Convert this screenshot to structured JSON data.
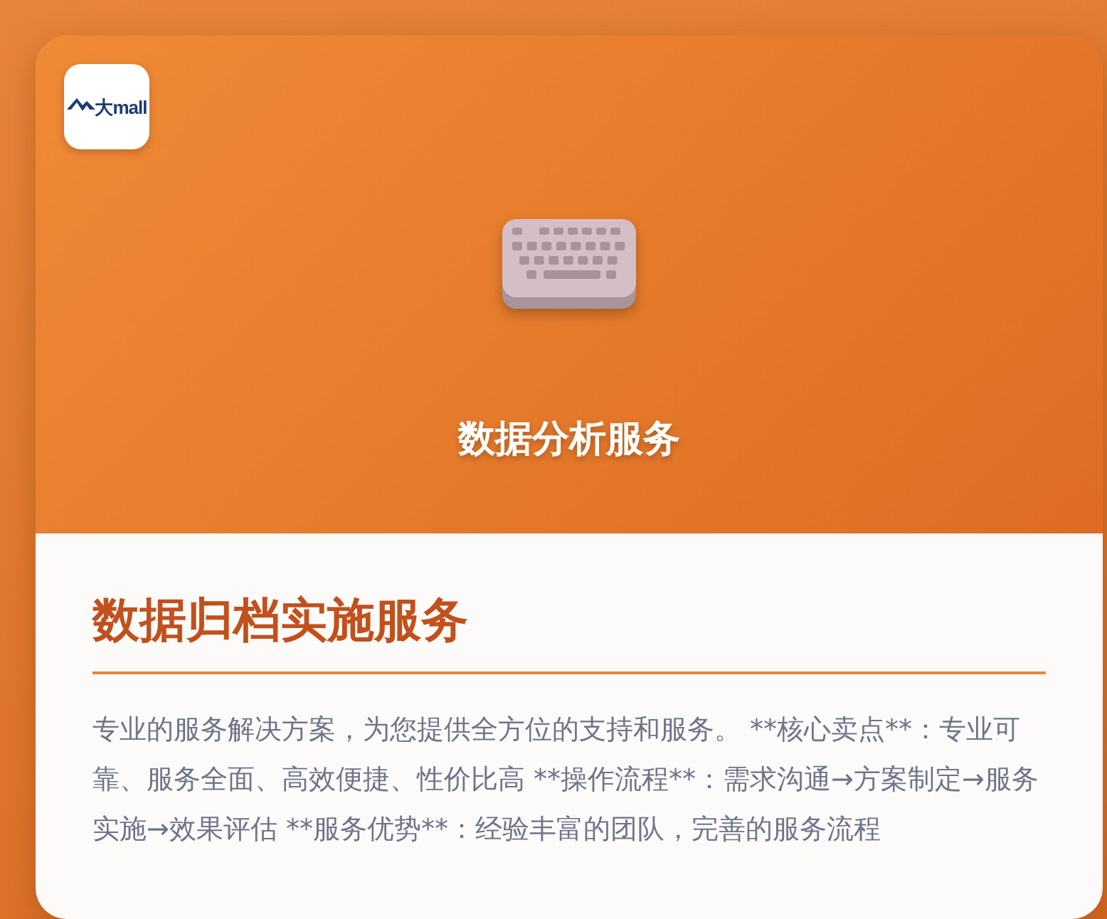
{
  "header": {
    "logo_text": "大mall",
    "title": "数据分析服务"
  },
  "content": {
    "heading": "数据归档实施服务",
    "description": "专业的服务解决方案，为您提供全方位的支持和服务。 **核心卖点**：专业可靠、服务全面、高效便捷、性价比高 **操作流程**：需求沟通→方案制定→服务实施→效果评估 **服务优势**：经验丰富的团队，完善的服务流程"
  }
}
